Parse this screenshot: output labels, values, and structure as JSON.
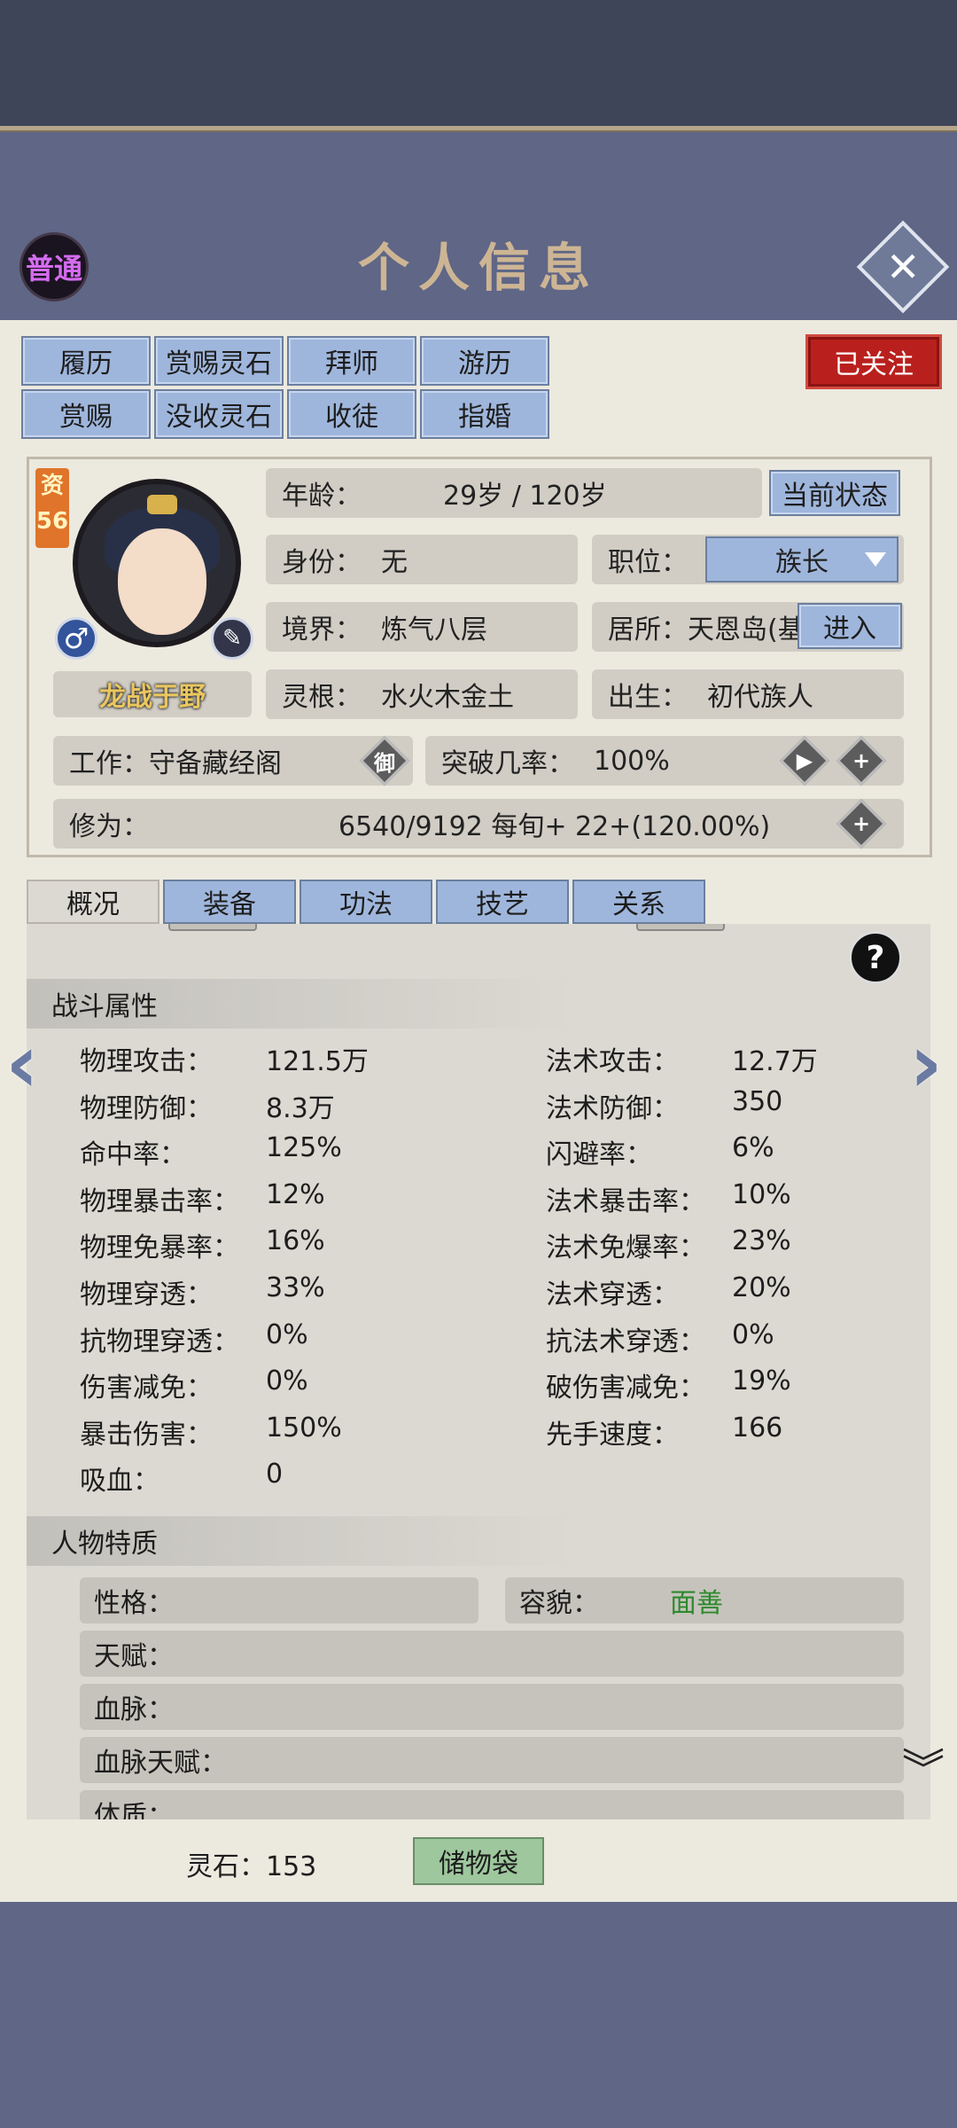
{
  "header": {
    "mode_badge": "普通",
    "title": "个人信息"
  },
  "action_buttons": [
    {
      "label": "履历"
    },
    {
      "label": "赏赐灵石"
    },
    {
      "label": "拜师"
    },
    {
      "label": "游历"
    },
    {
      "label": "赏赐"
    },
    {
      "label": "没收灵石"
    },
    {
      "label": "收徒"
    },
    {
      "label": "指婚"
    }
  ],
  "followed_label": "已关注",
  "character": {
    "qualification_label": "资",
    "qualification_value": "56",
    "gender_symbol": "♂",
    "name": "龙战于野",
    "age_label": "年龄：",
    "age_value": "29岁 / 120岁",
    "status_button": "当前状态",
    "identity_label": "身份：",
    "identity_value": "无",
    "position_label": "职位：",
    "position_value": "族长",
    "realm_label": "境界：",
    "realm_value": "炼气八层",
    "residence_label": "居所：",
    "residence_value": "天恩岛(基",
    "enter_button": "进入",
    "root_label": "灵根：",
    "root_value": "水火木金土",
    "birth_label": "出生：",
    "birth_value": "初代族人",
    "job_label": "工作：",
    "job_value": "守备藏经阁",
    "job_icon_char": "御",
    "breakthrough_label": "突破几率：",
    "breakthrough_value": "100%",
    "cultivation_label": "修为：",
    "cultivation_value": "6540/9192  每旬+  22+(120.00%)"
  },
  "tabs": [
    {
      "label": "概况"
    },
    {
      "label": "装备"
    },
    {
      "label": "功法"
    },
    {
      "label": "技艺"
    },
    {
      "label": "关系"
    }
  ],
  "combat": {
    "title": "战斗属性",
    "left": [
      {
        "label": "物理攻击：",
        "value": "121.5万"
      },
      {
        "label": "物理防御：",
        "value": "8.3万"
      },
      {
        "label": "命中率：",
        "value": "125%"
      },
      {
        "label": "物理暴击率：",
        "value": "12%"
      },
      {
        "label": "物理免暴率：",
        "value": "16%"
      },
      {
        "label": "物理穿透：",
        "value": "33%"
      },
      {
        "label": "抗物理穿透：",
        "value": "0%"
      },
      {
        "label": "伤害减免：",
        "value": "0%"
      },
      {
        "label": "暴击伤害：",
        "value": "150%"
      },
      {
        "label": "吸血：",
        "value": "0"
      }
    ],
    "right": [
      {
        "label": "法术攻击：",
        "value": "12.7万"
      },
      {
        "label": "法术防御：",
        "value": "350"
      },
      {
        "label": "闪避率：",
        "value": "6%"
      },
      {
        "label": "法术暴击率：",
        "value": "10%"
      },
      {
        "label": "法术免爆率：",
        "value": "23%"
      },
      {
        "label": "法术穿透：",
        "value": "20%"
      },
      {
        "label": "抗法术穿透：",
        "value": "0%"
      },
      {
        "label": "破伤害减免：",
        "value": "19%"
      },
      {
        "label": "先手速度：",
        "value": "166"
      }
    ]
  },
  "traits": {
    "title": "人物特质",
    "personality_label": "性格：",
    "appearance_label": "容貌：",
    "appearance_value": "面善",
    "talent_label": "天赋：",
    "bloodline_label": "血脉：",
    "bloodline_talent_label": "血脉天赋：",
    "physique_label": "体质："
  },
  "footer": {
    "stones_label": "灵石：153",
    "bag_button": "储物袋"
  },
  "colors": {
    "accent_blue": "#9fb6dc",
    "followed_red": "#b9201d",
    "good_green": "#2d8a2d",
    "mode_purple": "#d56cf0"
  }
}
